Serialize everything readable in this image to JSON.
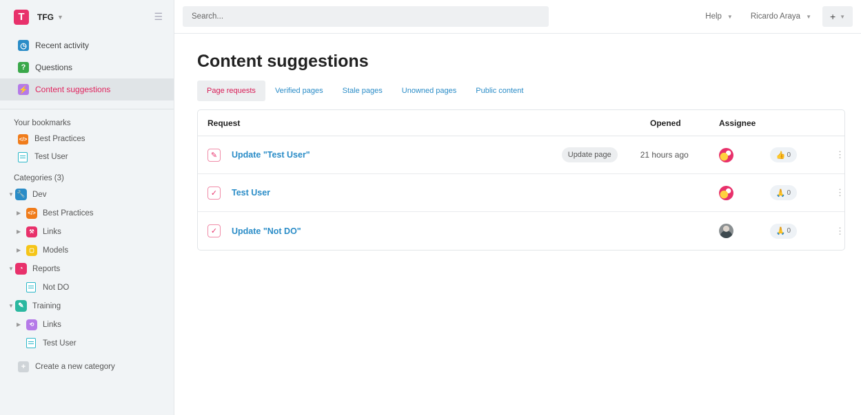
{
  "brand": {
    "name": "TFG",
    "logo_letter": "T",
    "logo_color": "#e8316b"
  },
  "nav": [
    {
      "label": "Recent activity",
      "icon": "clock-icon",
      "color": "#2a8cc7",
      "glyph": "◷"
    },
    {
      "label": "Questions",
      "icon": "question-icon",
      "color": "#3aa84a",
      "glyph": "?"
    },
    {
      "label": "Content suggestions",
      "icon": "bolt-icon",
      "color": "#b57ae8",
      "glyph": "⚡",
      "active": true
    }
  ],
  "bookmarks": {
    "title": "Your bookmarks",
    "items": [
      {
        "label": "Best Practices",
        "icon": "code-icon"
      },
      {
        "label": "Test User",
        "icon": "document-icon"
      }
    ]
  },
  "categories": {
    "title": "Categories (3)",
    "items": [
      {
        "label": "Dev",
        "level": 0,
        "expanded": true,
        "icon": "wrench-icon",
        "color": "#2a8cc7",
        "glyph": "🔧"
      },
      {
        "label": "Best Practices",
        "level": 1,
        "icon": "code-icon",
        "color": "#f07c1b",
        "glyph": "</>"
      },
      {
        "label": "Links",
        "level": 1,
        "icon": "hammer-icon",
        "color": "#e8316b",
        "glyph": "⚒"
      },
      {
        "label": "Models",
        "level": 1,
        "icon": "square-icon",
        "color": "#f5c518",
        "glyph": "▢"
      },
      {
        "label": "Reports",
        "level": 0,
        "expanded": true,
        "icon": "pie-chart-icon",
        "color": "#e8316b",
        "glyph": "◔"
      },
      {
        "label": "Not DO",
        "level": 1,
        "doc": true,
        "icon": "page-icon"
      },
      {
        "label": "Training",
        "level": 0,
        "expanded": true,
        "icon": "pencil-icon",
        "color": "#2bb8a0",
        "glyph": "✎"
      },
      {
        "label": "Links",
        "level": 1,
        "icon": "link-icon",
        "color": "#b57ae8",
        "glyph": "⟲"
      },
      {
        "label": "Test User",
        "level": 1,
        "doc": true,
        "icon": "document-icon"
      }
    ],
    "new_label": "Create a new category"
  },
  "topbar": {
    "search_placeholder": "Search...",
    "help_label": "Help",
    "user_label": "Ricardo Araya",
    "plus_label": "+"
  },
  "main": {
    "title": "Content suggestions",
    "tabs": [
      "Page requests",
      "Verified pages",
      "Stale pages",
      "Unowned pages",
      "Public content"
    ],
    "active_tab": 0,
    "columns": {
      "request": "Request",
      "opened": "Opened",
      "assignee": "Assignee"
    },
    "rows": [
      {
        "title": "Update \"Test User\"",
        "icon": "pencil-icon",
        "pill": "Update page",
        "opened": "21 hours ago",
        "avatar": "a",
        "vote_icon": "thumbs-up-icon",
        "votes": "0"
      },
      {
        "title": "Test User",
        "icon": "check-icon",
        "pill": "",
        "opened": "",
        "avatar": "a",
        "vote_icon": "praying-hands-icon",
        "votes": "0"
      },
      {
        "title": "Update \"Not DO\"",
        "icon": "check-icon",
        "pill": "",
        "opened": "",
        "avatar": "b",
        "vote_icon": "praying-hands-icon",
        "votes": "0"
      }
    ]
  }
}
